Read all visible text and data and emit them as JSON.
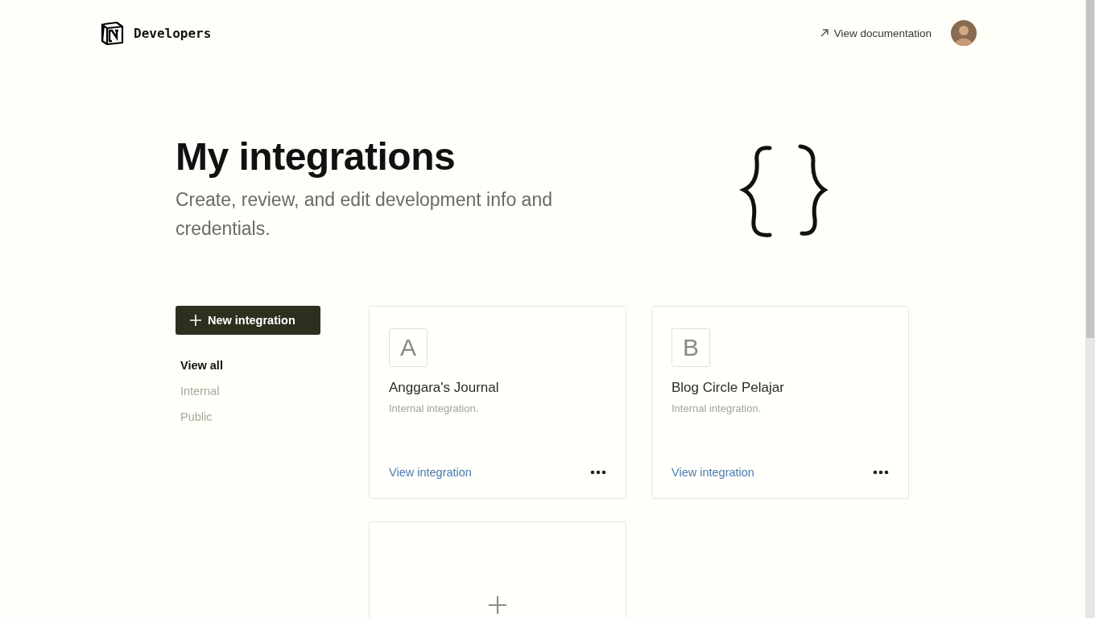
{
  "header": {
    "brand": "Developers",
    "doc_link": "View documentation"
  },
  "hero": {
    "title": "My integrations",
    "subtitle": "Create, review, and edit development info and credentials."
  },
  "new_button": "New integration",
  "filters": [
    {
      "label": "View all",
      "selected": true
    },
    {
      "label": "Internal",
      "selected": false
    },
    {
      "label": "Public",
      "selected": false
    }
  ],
  "integrations": [
    {
      "kind": "integration",
      "initial": "A",
      "name": "Anggara's Journal",
      "description": "Internal integration.",
      "link": "View integration"
    },
    {
      "kind": "integration",
      "initial": "B",
      "name": "Blog Circle Pelajar",
      "description": "Internal integration.",
      "link": "View integration"
    },
    {
      "kind": "add"
    }
  ]
}
